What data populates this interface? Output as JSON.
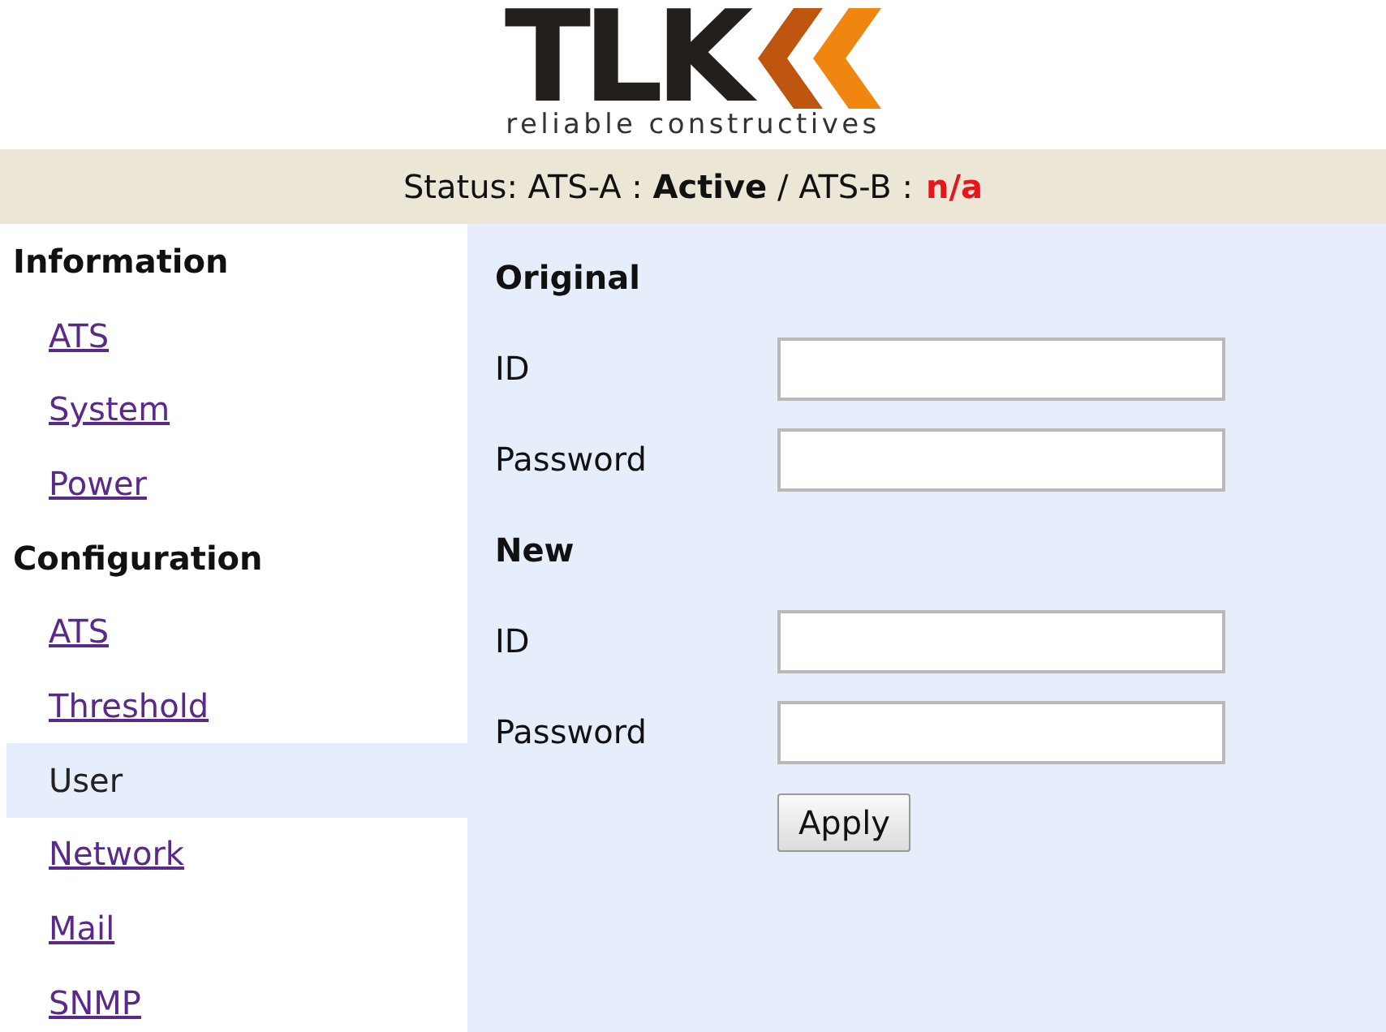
{
  "logo": {
    "text": "TLK",
    "tagline": "reliable constructives"
  },
  "status": {
    "text": "Status: ATS-A : **Active** / ATS-B :",
    "ats_b_value": "n/a",
    "ats_b_alarm": true
  },
  "sidebar": {
    "groups": [
      {
        "title": "Information",
        "items": [
          {
            "label": "ATS",
            "selected": false
          },
          {
            "label": "System",
            "selected": false
          },
          {
            "label": "Power",
            "selected": false
          }
        ]
      },
      {
        "title": "Configuration",
        "items": [
          {
            "label": "ATS",
            "selected": false
          },
          {
            "label": "Threshold",
            "selected": false
          },
          {
            "label": "User",
            "selected": true
          },
          {
            "label": "Network",
            "selected": false
          },
          {
            "label": "Mail",
            "selected": false
          },
          {
            "label": "SNMP",
            "selected": false
          }
        ]
      }
    ]
  },
  "form": {
    "sections": [
      {
        "title": "Original",
        "fields": [
          {
            "label": "ID"
          },
          {
            "label": "Password"
          }
        ]
      },
      {
        "title": "New",
        "fields": [
          {
            "label": "ID"
          },
          {
            "label": "Password"
          }
        ]
      }
    ],
    "button": "Apply"
  }
}
